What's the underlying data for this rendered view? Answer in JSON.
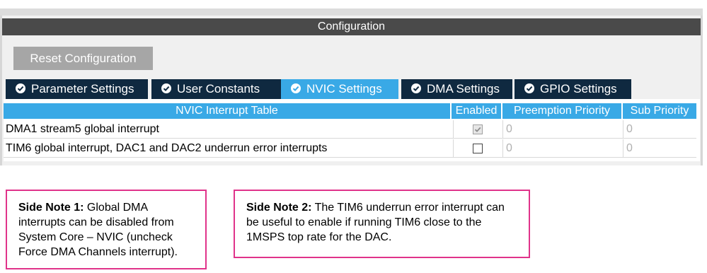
{
  "config": {
    "title": "Configuration",
    "reset_label": "Reset Configuration"
  },
  "tabs": [
    {
      "label": "Parameter Settings",
      "icon": "check-circle-icon"
    },
    {
      "label": "User Constants",
      "icon": "check-circle-icon"
    },
    {
      "label": "NVIC Settings",
      "icon": "check-circle-icon",
      "active": true
    },
    {
      "label": "DMA Settings",
      "icon": "check-circle-icon"
    },
    {
      "label": "GPIO Settings",
      "icon": "check-circle-icon"
    }
  ],
  "table": {
    "headers": [
      "NVIC Interrupt Table",
      "Enabled",
      "Preemption Priority",
      "Sub Priority"
    ],
    "rows": [
      {
        "name": "DMA1 stream5 global interrupt",
        "enabled": true,
        "enabled_locked": true,
        "preemption": "0",
        "sub": "0"
      },
      {
        "name": "TIM6 global interrupt, DAC1 and DAC2 underrun error interrupts",
        "enabled": false,
        "enabled_locked": false,
        "preemption": "0",
        "sub": "0"
      }
    ]
  },
  "notes": [
    {
      "heading": "Side Note 1:",
      "body": "Global DMA interrupts can be disabled from System Core – NVIC (uncheck Force DMA Channels interrupt)."
    },
    {
      "heading": "Side Note 2:",
      "body": "The TIM6 underrun error interrupt can be useful to enable if running TIM6 close to the 1MSPS top rate for the DAC."
    }
  ],
  "colors": {
    "tab_dark": "#0f2940",
    "tab_active": "#39a9e6",
    "header_dark": "#4a4a4a",
    "note_border": "#e0338a"
  }
}
